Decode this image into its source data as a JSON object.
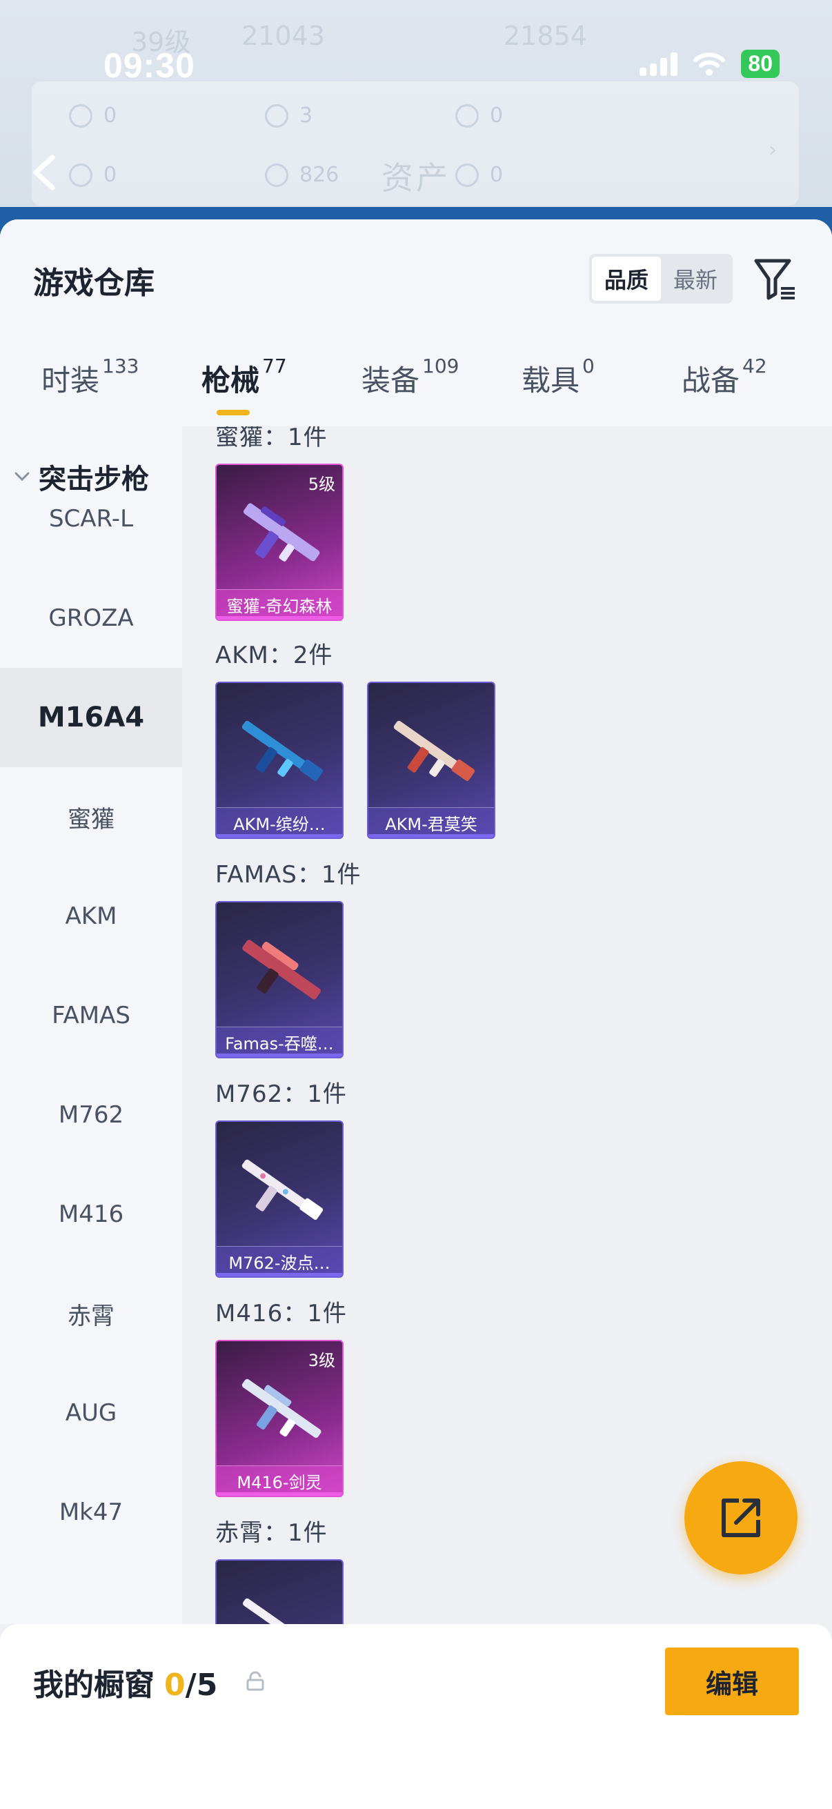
{
  "status_bar": {
    "time": "09:30",
    "battery": "80"
  },
  "background": {
    "level": "39级",
    "stat_a": "21043",
    "stat_b": "21854",
    "row1": [
      "0",
      "3",
      "0"
    ],
    "row2": [
      "0",
      "826",
      "0"
    ],
    "title": "资产"
  },
  "sheet": {
    "title": "游戏仓库",
    "sort": {
      "quality": "品质",
      "latest": "最新"
    }
  },
  "tabs": [
    {
      "label": "时装",
      "count": "133"
    },
    {
      "label": "枪械",
      "count": "77"
    },
    {
      "label": "装备",
      "count": "109"
    },
    {
      "label": "载具",
      "count": "0"
    },
    {
      "label": "战备",
      "count": "42"
    }
  ],
  "side": {
    "group": "突击步枪",
    "items": [
      "SCAR-L",
      "GROZA",
      "M16A4",
      "蜜獾",
      "AKM",
      "FAMAS",
      "M762",
      "M416",
      "赤霄",
      "AUG",
      "Mk47"
    ]
  },
  "sections": [
    {
      "title": "蜜獾：1件",
      "items": [
        {
          "name": "蜜獾-奇幻森林",
          "level": "5级",
          "rarity": "pink"
        }
      ]
    },
    {
      "title": "AKM：2件",
      "items": [
        {
          "name": "AKM-缤纷…",
          "level": "",
          "rarity": "purple"
        },
        {
          "name": "AKM-君莫笑",
          "level": "",
          "rarity": "purple"
        }
      ]
    },
    {
      "title": "FAMAS：1件",
      "items": [
        {
          "name": "Famas-吞噬…",
          "level": "",
          "rarity": "purple"
        }
      ]
    },
    {
      "title": "M762：1件",
      "items": [
        {
          "name": "M762-波点…",
          "level": "",
          "rarity": "purple"
        }
      ]
    },
    {
      "title": "M416：1件",
      "items": [
        {
          "name": "M416-剑灵",
          "level": "3级",
          "rarity": "pink"
        }
      ]
    },
    {
      "title": "赤霄：1件",
      "items": [
        {
          "name": "",
          "level": "",
          "rarity": "purple"
        }
      ]
    }
  ],
  "showcase": {
    "title": "我的橱窗",
    "count": "0",
    "total": "/5",
    "edit": "编辑"
  },
  "colors": {
    "accent": "#f7a912",
    "purple_card": "#5a48b0",
    "pink_card": "#d04ac8"
  }
}
